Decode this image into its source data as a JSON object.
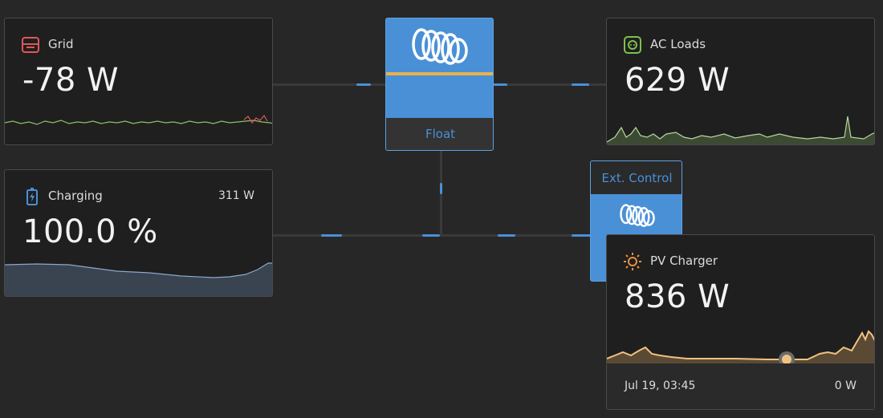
{
  "grid": {
    "title": "Grid",
    "value": "-78 W",
    "icon": "grid-icon"
  },
  "ac_loads": {
    "title": "AC Loads",
    "value": "629 W",
    "icon": "ac-outlet-icon"
  },
  "battery": {
    "title": "Charging",
    "value": "100.0 %",
    "power": "311 W",
    "icon": "battery-charging-icon"
  },
  "inverter": {
    "state": "Float",
    "brand_icon": "victron-logo-icon"
  },
  "solar_charger": {
    "label": "Ext. Control",
    "brand_icon": "victron-logo-icon"
  },
  "pv": {
    "title": "PV Charger",
    "value": "836 W",
    "timestamp": "Jul 19, 03:45",
    "timestamp_value": "0 W",
    "icon": "sun-icon"
  },
  "colors": {
    "accent": "#4a90d6",
    "grid": "#e05757",
    "ac": "#7fbf4d",
    "battery": "#4a90d6",
    "pv": "#e8913d",
    "pv_fill": "#f0c27f",
    "float_bar": "#e8b24d"
  }
}
